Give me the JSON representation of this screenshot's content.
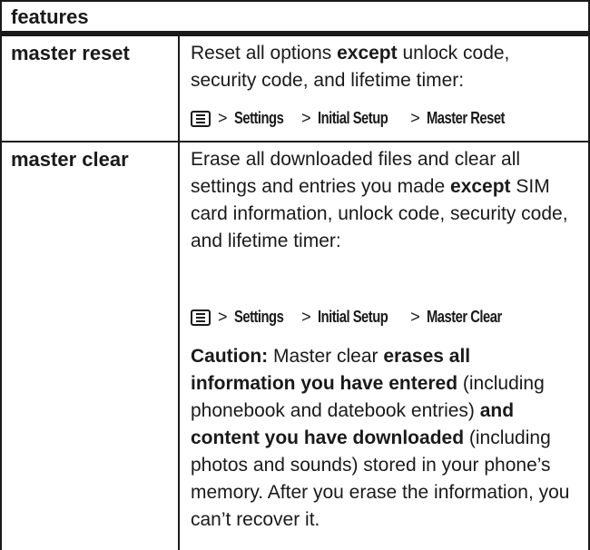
{
  "header": {
    "title": "features"
  },
  "rows": [
    {
      "feature": "master reset",
      "desc_parts": [
        "Reset all options ",
        "except",
        " unlock code, security code, and lifetime timer:"
      ],
      "path": {
        "icon": "menu-icon",
        "sep": ">",
        "items": [
          "Settings",
          "Initial Setup",
          "Master Reset"
        ]
      }
    },
    {
      "feature": "master clear",
      "desc_parts": [
        "Erase all downloaded files and clear all settings and entries you made ",
        "except",
        " SIM card information, unlock code, security code, and lifetime timer:"
      ],
      "path": {
        "icon": "menu-icon",
        "sep": ">",
        "items": [
          "Settings",
          "Initial Setup",
          "Master Clear"
        ]
      },
      "caution_parts": [
        "Caution:",
        " Master clear ",
        "erases all information you have entered",
        " (including phonebook and datebook entries) ",
        "and content you have downloaded",
        " (including photos and sounds) stored in your phone’s memory. After you erase the information, you can’t recover it."
      ]
    }
  ]
}
